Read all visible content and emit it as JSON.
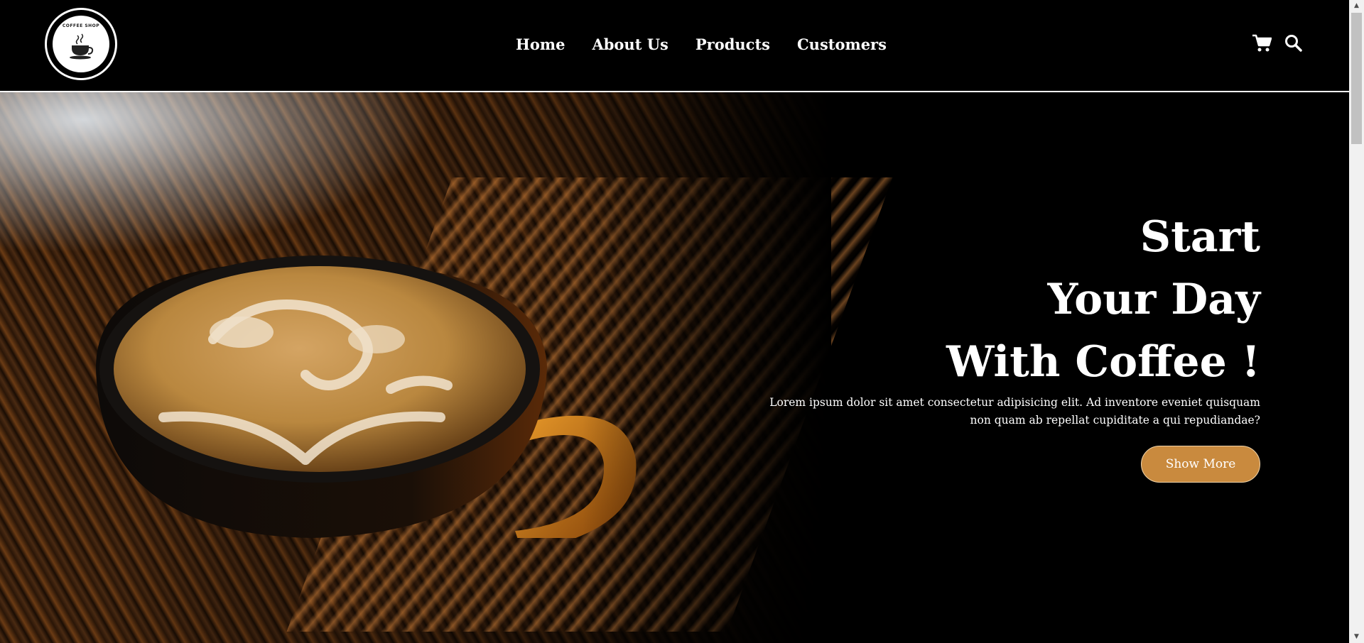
{
  "logo": {
    "text": "COFFEE SHOP"
  },
  "nav": {
    "items": [
      {
        "label": "Home"
      },
      {
        "label": "About Us"
      },
      {
        "label": "Products"
      },
      {
        "label": "Customers"
      }
    ]
  },
  "icons": {
    "cart": "cart-icon",
    "search": "search-icon"
  },
  "hero": {
    "title_lines": [
      "Start",
      "Your Day",
      "With Coffee !"
    ],
    "description": "Lorem ipsum dolor sit amet consectetur adipisicing elit. Ad inventore eveniet quisquam non quam ab repellat cupiditate a qui repudiandae?",
    "button_label": "Show More"
  },
  "colors": {
    "background": "#000000",
    "accent": "#C98A3E",
    "text": "#FFFFFF"
  }
}
